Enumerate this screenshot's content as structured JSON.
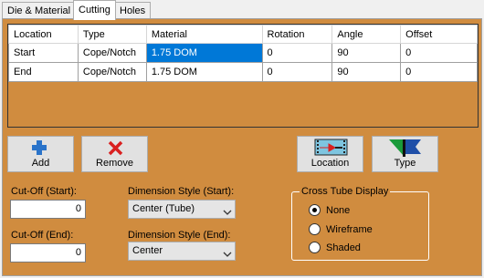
{
  "tabs": [
    {
      "label": "Die & Material",
      "active": false
    },
    {
      "label": "Cutting",
      "active": true
    },
    {
      "label": "Holes",
      "active": false
    }
  ],
  "grid": {
    "columns": [
      "Location",
      "Type",
      "Material",
      "Rotation",
      "Angle",
      "Offset"
    ],
    "rows": [
      [
        "Start",
        "Cope/Notch",
        "1.75 DOM",
        "0",
        "90",
        "0"
      ],
      [
        "End",
        "Cope/Notch",
        "1.75 DOM",
        "0",
        "90",
        "0"
      ]
    ]
  },
  "buttons": {
    "add": "Add",
    "remove": "Remove",
    "location": "Location",
    "type": "Type"
  },
  "cutoff_start": {
    "label": "Cut-Off (Start):",
    "value": "0"
  },
  "cutoff_end": {
    "label": "Cut-Off (End):",
    "value": "0"
  },
  "dim_start": {
    "label": "Dimension Style (Start):",
    "value": "Center (Tube)"
  },
  "dim_end": {
    "label": "Dimension Style (End):",
    "value": "Center"
  },
  "cross_tube": {
    "title": "Cross Tube Display",
    "options": [
      "None",
      "Wireframe",
      "Shaded"
    ],
    "selected": "None"
  },
  "colors": {
    "panel_bg": "#d08c3f",
    "selection": "#0078d7",
    "add_icon": "#2a73c9",
    "remove_icon": "#d92020"
  },
  "icons": {
    "add": "plus-icon",
    "remove": "x-icon",
    "location": "location-arrows-icon",
    "type": "type-flag-icon"
  }
}
